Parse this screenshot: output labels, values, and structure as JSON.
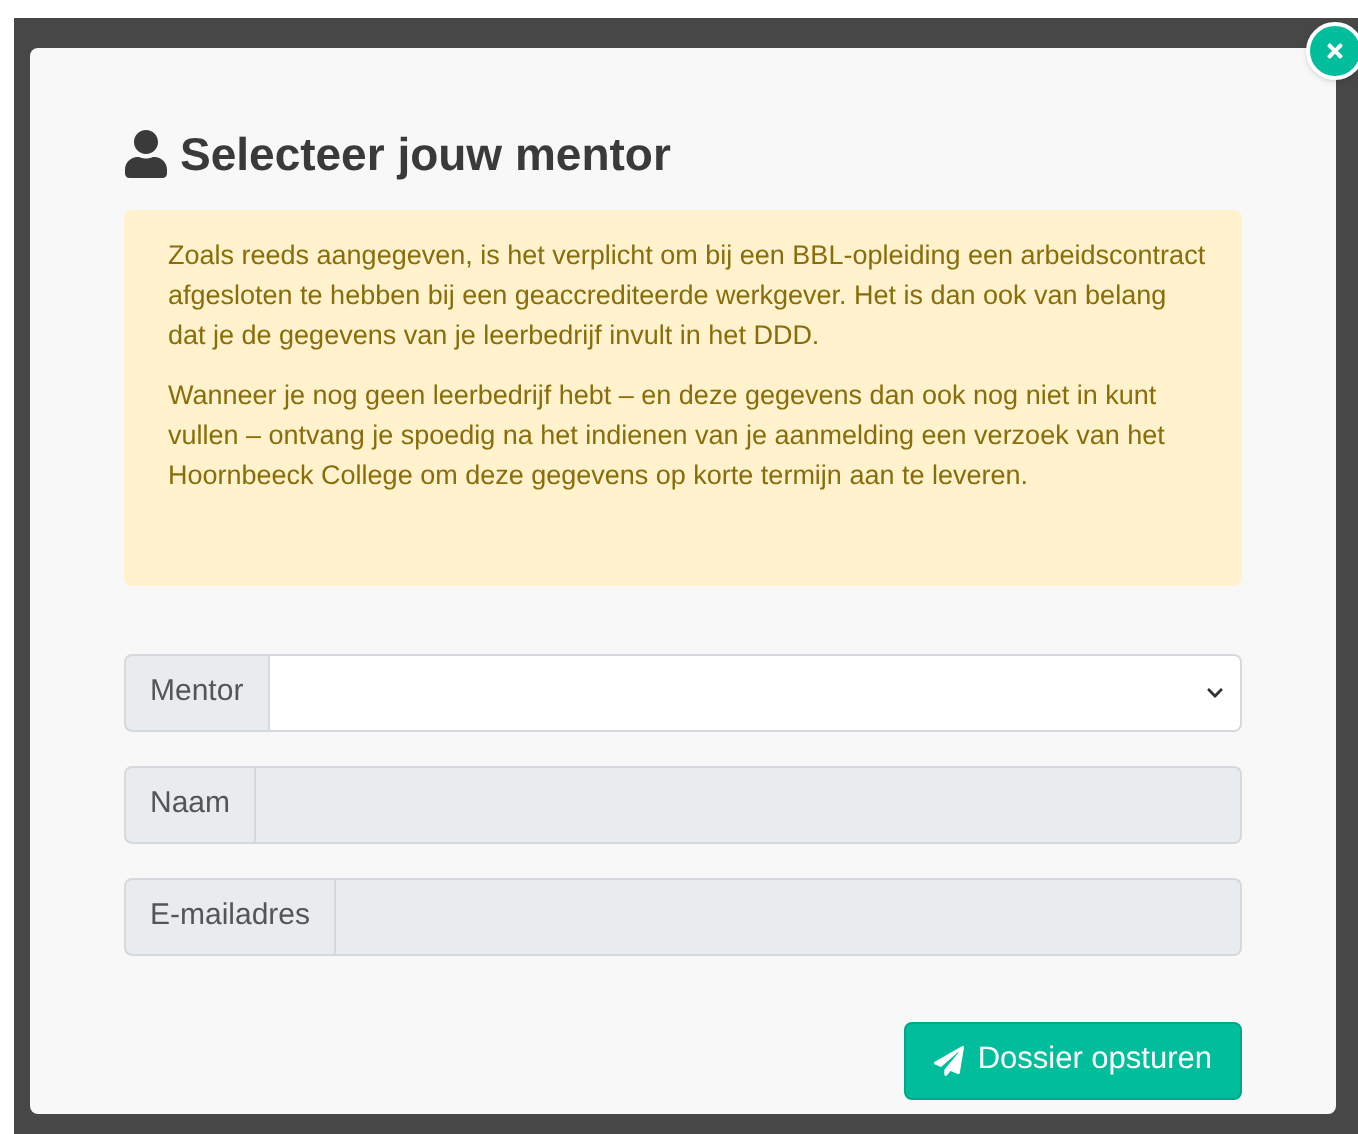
{
  "dialog": {
    "title": "Selecteer jouw mentor",
    "notice": [
      "Zoals reeds aangegeven, is het verplicht om bij een BBL-opleiding een arbeidscontract afgesloten te hebben bij een geaccrediteerde werkgever. Het is dan ook van belang dat je de gegevens van je leerbedrijf invult in het DDD.",
      "Wanneer je nog geen leerbedrijf hebt – en deze gegevens dan ook nog niet in kunt vullen – ontvang je spoedig na het indienen van je aanmelding een verzoek van het Hoornbeeck College om deze gegevens op korte termijn aan te leveren."
    ],
    "fields": [
      {
        "label": "Mentor",
        "kind": "select",
        "disabled": false
      },
      {
        "label": "Naam",
        "kind": "text",
        "disabled": true
      },
      {
        "label": "E-mailadres",
        "kind": "text",
        "disabled": true
      }
    ],
    "submit": "Dossier opsturen"
  }
}
